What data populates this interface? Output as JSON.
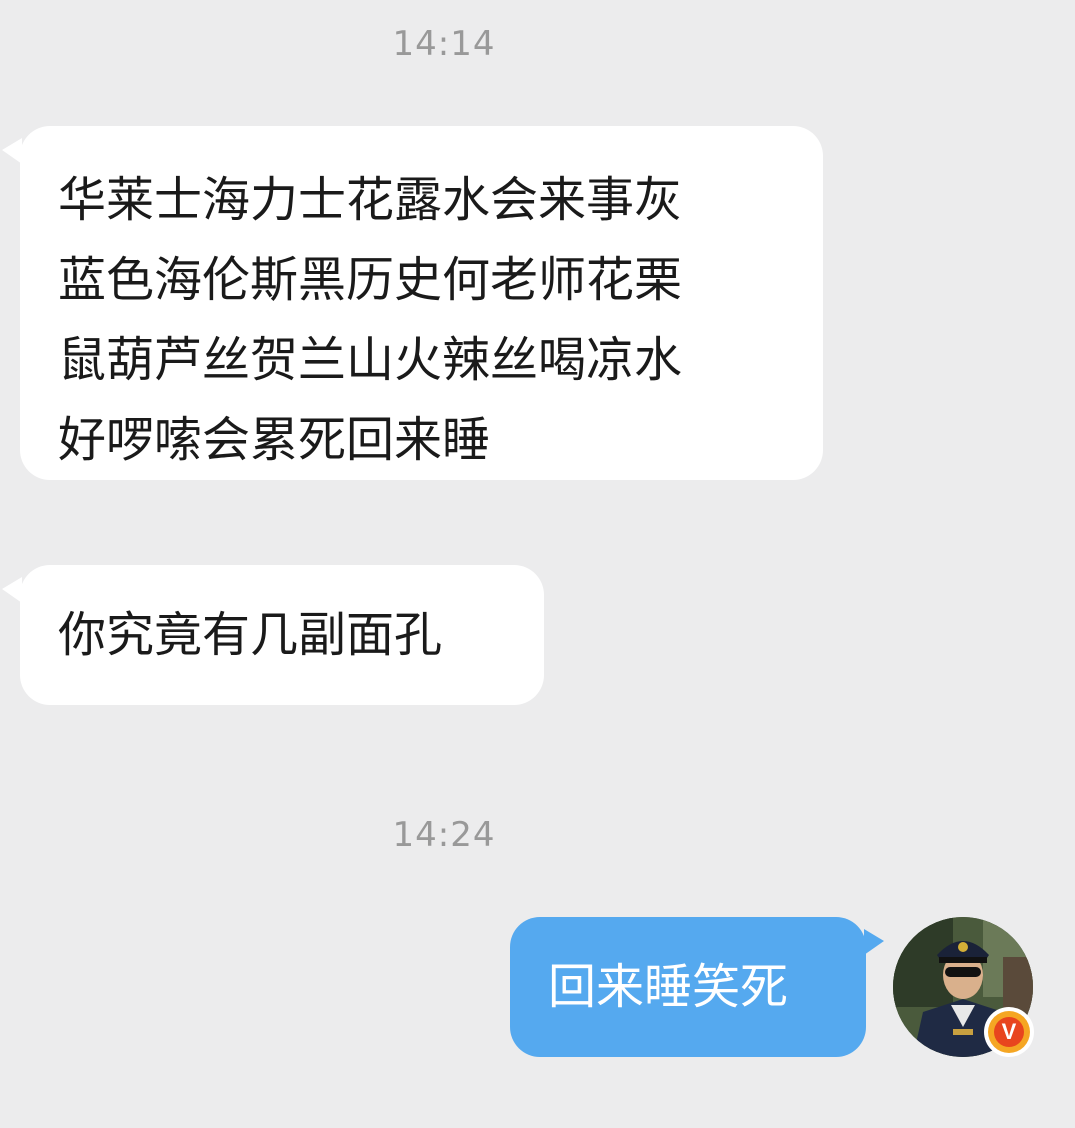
{
  "chat": {
    "timestamps": [
      "14:14",
      "14:24"
    ],
    "messages": [
      {
        "direction": "incoming",
        "lines": [
          "华莱士海力士花露水会来事灰",
          "蓝色海伦斯黑历史何老师花栗",
          "鼠葫芦丝贺兰山火辣丝喝凉水",
          "好啰嗦会累死回来睡"
        ]
      },
      {
        "direction": "incoming",
        "lines": [
          "你究竟有几副面孔"
        ]
      },
      {
        "direction": "outgoing",
        "lines": [
          "回来睡笑死"
        ]
      }
    ],
    "avatar": {
      "badge_letter": "V",
      "badge_colors": [
        "#f5a623",
        "#e8451e"
      ]
    }
  },
  "colors": {
    "background": "#ececed",
    "incoming_bubble": "#ffffff",
    "outgoing_bubble": "#55a9ef",
    "timestamp_text": "#999999"
  }
}
